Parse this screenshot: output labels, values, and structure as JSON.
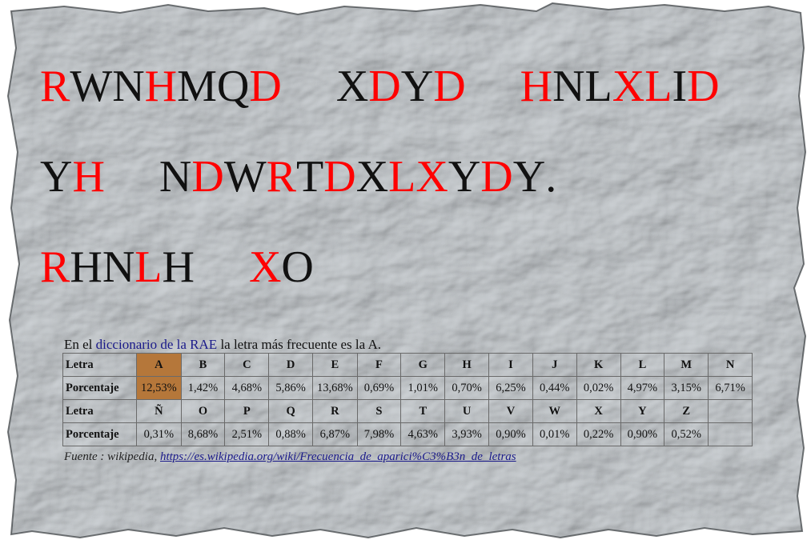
{
  "cipher": {
    "lines": [
      [
        [
          {
            "c": "R",
            "r": true
          },
          {
            "c": "W",
            "r": false
          },
          {
            "c": "N",
            "r": false
          },
          {
            "c": "H",
            "r": true
          },
          {
            "c": "M",
            "r": false
          },
          {
            "c": "Q",
            "r": false
          },
          {
            "c": "D",
            "r": true
          }
        ],
        [
          {
            "c": "X",
            "r": false
          },
          {
            "c": "D",
            "r": true
          },
          {
            "c": "Y",
            "r": false
          },
          {
            "c": "D",
            "r": true
          }
        ],
        [
          {
            "c": "H",
            "r": true
          },
          {
            "c": "N",
            "r": false
          },
          {
            "c": "L",
            "r": false
          },
          {
            "c": "X",
            "r": true
          },
          {
            "c": "L",
            "r": true
          },
          {
            "c": "I",
            "r": false
          },
          {
            "c": "D",
            "r": true
          }
        ]
      ],
      [
        [
          {
            "c": "Y",
            "r": false
          },
          {
            "c": "H",
            "r": true
          }
        ],
        [
          {
            "c": "N",
            "r": false
          },
          {
            "c": "D",
            "r": true
          },
          {
            "c": "W",
            "r": false
          },
          {
            "c": "R",
            "r": true
          },
          {
            "c": "T",
            "r": false
          },
          {
            "c": "D",
            "r": true
          },
          {
            "c": "X",
            "r": false
          },
          {
            "c": "L",
            "r": true
          },
          {
            "c": "X",
            "r": true
          },
          {
            "c": "Y",
            "r": false
          },
          {
            "c": "D",
            "r": true
          },
          {
            "c": "Y",
            "r": false
          },
          {
            "c": ".",
            "r": false
          }
        ]
      ],
      [
        [
          {
            "c": "R",
            "r": true
          },
          {
            "c": "H",
            "r": false
          },
          {
            "c": "N",
            "r": false
          },
          {
            "c": "L",
            "r": true
          },
          {
            "c": "H",
            "r": false
          }
        ],
        [
          {
            "c": "X",
            "r": true
          },
          {
            "c": "O",
            "r": false
          }
        ]
      ]
    ],
    "colors": {
      "highlight": "#ff0000",
      "normal": "#111111"
    }
  },
  "intro": {
    "before": "En el ",
    "link": "diccionario de la RAE",
    "after": " la letra más frecuente es la A."
  },
  "table": {
    "header_letter": "Letra",
    "header_percent": "Porcentaje",
    "highlight_color": "#b5773a",
    "rows": [
      {
        "letters": [
          "A",
          "B",
          "C",
          "D",
          "E",
          "F",
          "G",
          "H",
          "I",
          "J",
          "K",
          "L",
          "M",
          "N"
        ],
        "percents": [
          "12,53%",
          "1,42%",
          "4,68%",
          "5,86%",
          "13,68%",
          "0,69%",
          "1,01%",
          "0,70%",
          "6,25%",
          "0,44%",
          "0,02%",
          "4,97%",
          "3,15%",
          "6,71%"
        ]
      },
      {
        "letters": [
          "Ñ",
          "O",
          "P",
          "Q",
          "R",
          "S",
          "T",
          "U",
          "V",
          "W",
          "X",
          "Y",
          "Z",
          ""
        ],
        "percents": [
          "0,31%",
          "8,68%",
          "2,51%",
          "0,88%",
          "6,87%",
          "7,98%",
          "4,63%",
          "3,93%",
          "0,90%",
          "0,01%",
          "0,22%",
          "0,90%",
          "0,52%",
          ""
        ]
      }
    ]
  },
  "source": {
    "label": "Fuente : wikipedia, ",
    "url": "https://es.wikipedia.org/wiki/Frecuencia_de_aparici%C3%B3n_de_letras"
  }
}
